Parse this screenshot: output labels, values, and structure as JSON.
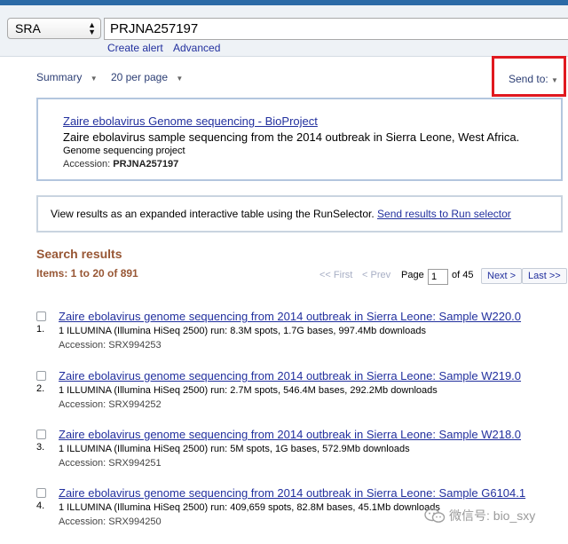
{
  "search": {
    "database": "SRA",
    "term": "PRJNA257197",
    "create_alert": "Create alert",
    "advanced": "Advanced"
  },
  "display": {
    "summary": "Summary",
    "per_page": "20 per page",
    "send_to": "Send to:"
  },
  "bioproject": {
    "title": "Zaire ebolavirus Genome sequencing - BioProject",
    "description": "Zaire ebolavirus sample sequencing from the 2014 outbreak in Sierra Leone, West Africa.",
    "type": "Genome sequencing project",
    "accession_label": "Accession: ",
    "accession": "PRJNA257197"
  },
  "runselector": {
    "text": "View results as an expanded interactive table using the RunSelector. ",
    "link": "Send results to Run selector"
  },
  "results": {
    "heading": "Search results",
    "items": "Items: 1 to 20 of 891",
    "pager": {
      "first": "<< First",
      "prev": "< Prev",
      "page_label": "Page",
      "page_value": "1",
      "of": "of 45",
      "next": "Next >",
      "last": "Last >>"
    },
    "list": [
      {
        "num": "1.",
        "title": "Zaire ebolavirus genome sequencing from 2014 outbreak in Sierra Leone: Sample W220.0",
        "desc": "1 ILLUMINA (Illumina HiSeq 2500) run: 8.3M spots, 1.7G bases, 997.4Mb downloads",
        "accession": "Accession: SRX994253"
      },
      {
        "num": "2.",
        "title": "Zaire ebolavirus genome sequencing from 2014 outbreak in Sierra Leone: Sample W219.0",
        "desc": "1 ILLUMINA (Illumina HiSeq 2500) run: 2.7M spots, 546.4M bases, 292.2Mb downloads",
        "accession": "Accession: SRX994252"
      },
      {
        "num": "3.",
        "title": "Zaire ebolavirus genome sequencing from 2014 outbreak in Sierra Leone: Sample W218.0",
        "desc": "1 ILLUMINA (Illumina HiSeq 2500) run: 5M spots, 1G bases, 572.9Mb downloads",
        "accession": "Accession: SRX994251"
      },
      {
        "num": "4.",
        "title": "Zaire ebolavirus genome sequencing from 2014 outbreak in Sierra Leone: Sample G6104.1",
        "desc": "1 ILLUMINA (Illumina HiSeq 2500) run: 409,659 spots, 82.8M bases, 45.1Mb downloads",
        "accession": "Accession: SRX994250"
      }
    ]
  },
  "watermark": "微信号: bio_sxy",
  "colors": {
    "link": "#22309e",
    "results_heading": "#985735",
    "highlight_box": "#e0191f",
    "box_border": "#b3c6de"
  }
}
